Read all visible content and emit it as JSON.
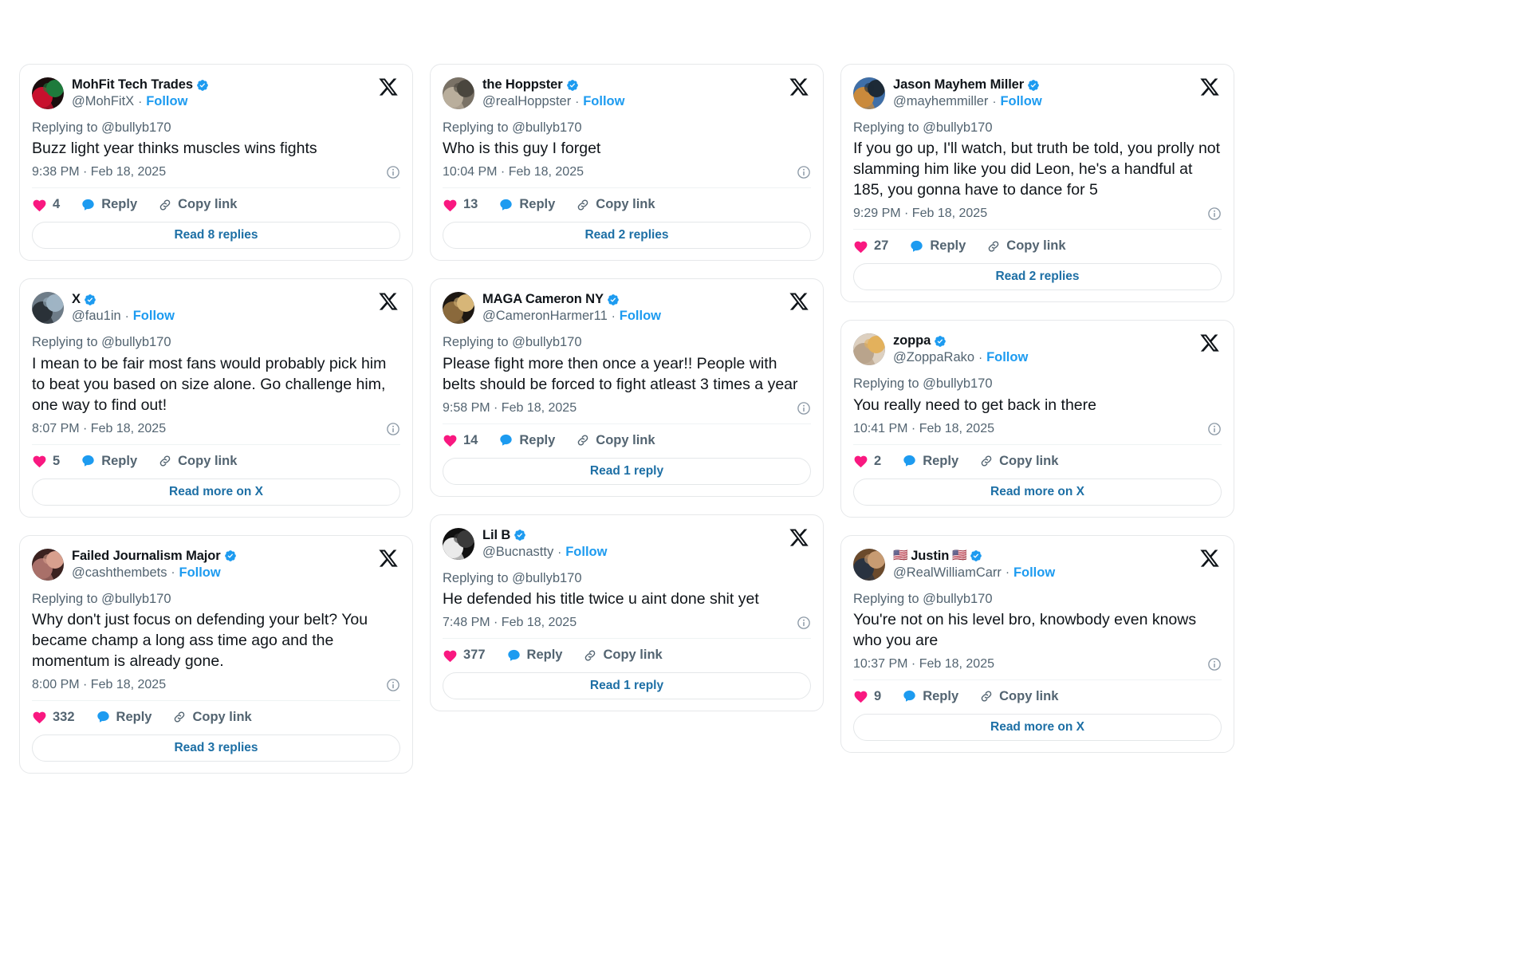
{
  "theme": {
    "accent_blue": "#1d9bf0",
    "link_blue": "#1d6fa5",
    "heart_pink": "#f91880",
    "text_primary": "#0f1419",
    "text_secondary": "#536471",
    "card_border": "#e6e8ea",
    "background": "#ffffff"
  },
  "labels": {
    "follow": "Follow",
    "reply": "Reply",
    "copy_link": "Copy link",
    "separator": "·"
  },
  "columns": [
    {
      "cards": [
        {
          "display_name": "MohFit Tech Trades",
          "handle": "@MohFitX",
          "verified": true,
          "replying_to": "Replying to @bullyb170",
          "text": "Buzz light year thinks muscles wins fights",
          "timestamp": "9:38 PM · Feb 18, 2025",
          "likes": "4",
          "read_button": "Read 8 replies",
          "avatar_colors": [
            "#1a0d0d",
            "#c8102e",
            "#1e7b3c"
          ]
        },
        {
          "display_name": "X",
          "handle": "@fau1in",
          "verified": true,
          "replying_to": "Replying to @bullyb170",
          "text": "I mean to be fair most fans would probably pick him to beat you based on size alone. Go challenge him, one way to find out!",
          "timestamp": "8:07 PM · Feb 18, 2025",
          "likes": "5",
          "read_button": "Read more on X",
          "avatar_colors": [
            "#6e7c88",
            "#2b3238",
            "#9fb4c4"
          ]
        },
        {
          "display_name": "Failed Journalism Major",
          "handle": "@cashthembets",
          "verified": true,
          "replying_to": "Replying to @bullyb170",
          "text": "Why don't just focus on defending your belt? You became champ a long ass time ago and the momentum is already gone.",
          "timestamp": "8:00 PM · Feb 18, 2025",
          "likes": "332",
          "read_button": "Read 3 replies",
          "avatar_colors": [
            "#3b2220",
            "#a9706a",
            "#d8a08e"
          ]
        }
      ]
    },
    {
      "cards": [
        {
          "display_name": "the Hoppster",
          "handle": "@realHoppster",
          "verified": true,
          "replying_to": "Replying to @bullyb170",
          "text": "Who is this guy I forget",
          "timestamp": "10:04 PM · Feb 18, 2025",
          "likes": "13",
          "read_button": "Read 2 replies",
          "avatar_colors": [
            "#7a7266",
            "#b9ae9c",
            "#4a463e"
          ]
        },
        {
          "display_name": "MAGA Cameron NY",
          "handle": "@CameronHarmer11",
          "verified": true,
          "replying_to": "Replying to @bullyb170",
          "text": "Please fight more then once a year!! People with belts should be forced to fight atleast 3 times a year",
          "timestamp": "9:58 PM · Feb 18, 2025",
          "likes": "14",
          "read_button": "Read 1 reply",
          "avatar_colors": [
            "#1c1712",
            "#8a6a3c",
            "#d7b678"
          ]
        },
        {
          "display_name": "Lil B",
          "handle": "@Bucnastty",
          "verified": true,
          "replying_to": "Replying to @bullyb170",
          "text": "He defended his title twice u aint done shit yet",
          "timestamp": "7:48 PM · Feb 18, 2025",
          "likes": "377",
          "read_button": "Read 1 reply",
          "avatar_colors": [
            "#101010",
            "#e9e9e9",
            "#3a3a3a"
          ]
        }
      ]
    },
    {
      "cards": [
        {
          "display_name": "Jason Mayhem Miller",
          "handle": "@mayhemmiller",
          "verified": true,
          "replying_to": "Replying to @bullyb170",
          "text": "If you go up, I'll watch, but truth be told, you prolly not slamming him like you did Leon, he's a handful at 185, you gonna have to dance for 5",
          "timestamp": "9:29 PM · Feb 18, 2025",
          "likes": "27",
          "read_button": "Read 2 replies",
          "avatar_colors": [
            "#3f6fa8",
            "#c98a3c",
            "#1d2a36"
          ]
        },
        {
          "display_name": "zoppa",
          "handle": "@ZoppaRako",
          "verified": true,
          "replying_to": "Replying to @bullyb170",
          "text": "You really need to get back in there",
          "timestamp": "10:41 PM · Feb 18, 2025",
          "likes": "2",
          "read_button": "Read more on X",
          "avatar_colors": [
            "#ddd0c0",
            "#b9a48c",
            "#e3b15c"
          ]
        },
        {
          "display_name": "Justin",
          "name_prefix_flag": "🇺🇸",
          "name_suffix_flag": "🇺🇸",
          "handle": "@RealWilliamCarr",
          "verified": true,
          "replying_to": "Replying to @bullyb170",
          "text": "You're not on his level bro, knowbody even knows who you are",
          "timestamp": "10:37 PM · Feb 18, 2025",
          "likes": "9",
          "read_button": "Read more on X",
          "avatar_colors": [
            "#6b4a2c",
            "#2a3340",
            "#c79b72"
          ]
        }
      ]
    }
  ]
}
